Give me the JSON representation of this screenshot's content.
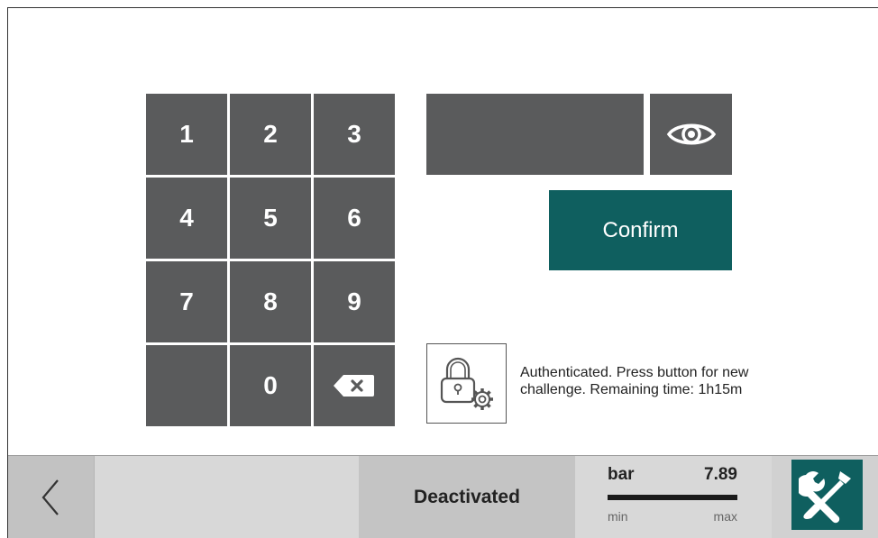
{
  "keypad": {
    "keys": [
      "1",
      "2",
      "3",
      "4",
      "5",
      "6",
      "7",
      "8",
      "9",
      "",
      "0",
      ""
    ]
  },
  "password": {
    "value": "",
    "visibility_icon": "eye-icon"
  },
  "confirm": {
    "label": "Confirm"
  },
  "auth": {
    "icon": "lock-gear-icon",
    "message": "Authenticated. Press button for new challenge. Remaining time: 1h15m"
  },
  "bottom": {
    "back_icon": "chevron-left-icon",
    "status": "Deactivated",
    "gauge": {
      "unit": "bar",
      "value": "7.89",
      "min_label": "min",
      "max_label": "max",
      "fill_fraction": 1.0
    },
    "tools_icon": "wrench-screwdriver-icon"
  },
  "colors": {
    "key_bg": "#5a5b5c",
    "accent": "#0f5f5f",
    "bar_bg": "#d1d1d1"
  }
}
